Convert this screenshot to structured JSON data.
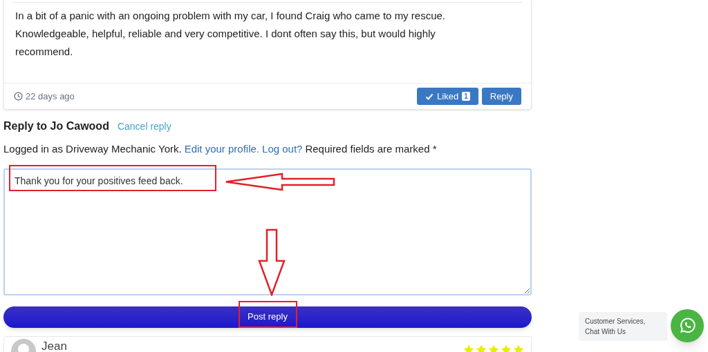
{
  "review": {
    "text": "In a bit of a panic with an ongoing problem with my car, I found Craig who came to my rescue. Knowledgeable, helpful, reliable and very competitive. I dont often say this, but would highly recommend.",
    "time": "22 days ago",
    "like_button": {
      "label": "Liked",
      "count": "1"
    },
    "reply_button": "Reply"
  },
  "reply_form": {
    "title": "Reply to Jo Cawood",
    "cancel_link": "Cancel reply",
    "logged_in_text": "Logged in as Driveway Mechanic York.",
    "edit_profile_link": "Edit your profile.",
    "logout_link": "Log out?",
    "required_text": "Required fields are marked *",
    "comment_value": "Thank you for your positives feed back.",
    "submit_button": "Post reply"
  },
  "next_review": {
    "author": "Jean",
    "stars": 5
  },
  "chat_widget": {
    "label": "Customer Services, Chat With Us"
  }
}
